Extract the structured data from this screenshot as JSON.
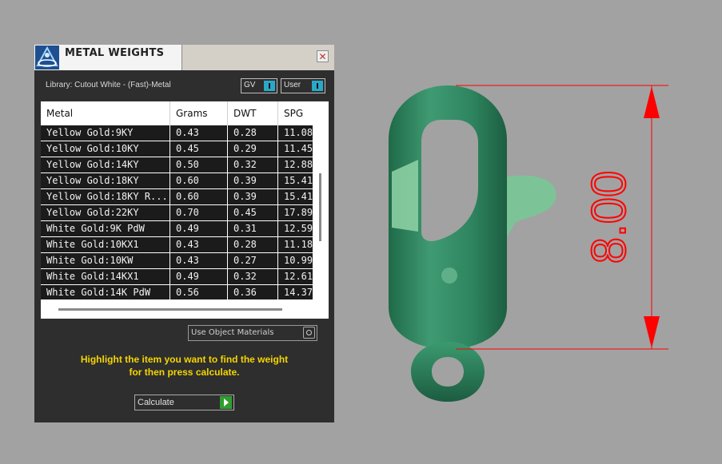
{
  "panel": {
    "title": "METAL WEIGHTS",
    "close_icon": "✕",
    "library_label": "Library: Cutout White - (Fast)-Metal",
    "gv_label": "GV",
    "user_label": "User",
    "use_object_materials": "Use Object Materials",
    "instructions_line1": "Highlight the item you want to find the weight",
    "instructions_line2": "for then press calculate.",
    "calculate_label": "Calculate"
  },
  "table": {
    "headers": [
      "Metal",
      "Grams",
      "DWT",
      "SPG"
    ],
    "rows": [
      {
        "metal": "Yellow Gold:9KY",
        "grams": "0.43",
        "dwt": "0.28",
        "spg": "11.08"
      },
      {
        "metal": "Yellow Gold:10KY",
        "grams": "0.45",
        "dwt": "0.29",
        "spg": "11.45"
      },
      {
        "metal": "Yellow Gold:14KY",
        "grams": "0.50",
        "dwt": "0.32",
        "spg": "12.88"
      },
      {
        "metal": "Yellow Gold:18KY",
        "grams": "0.60",
        "dwt": "0.39",
        "spg": "15.41"
      },
      {
        "metal": "Yellow Gold:18KY R...",
        "grams": "0.60",
        "dwt": "0.39",
        "spg": "15.41"
      },
      {
        "metal": "Yellow Gold:22KY",
        "grams": "0.70",
        "dwt": "0.45",
        "spg": "17.89"
      },
      {
        "metal": "White Gold:9K PdW",
        "grams": "0.49",
        "dwt": "0.31",
        "spg": "12.59"
      },
      {
        "metal": "White Gold:10KX1",
        "grams": "0.43",
        "dwt": "0.28",
        "spg": "11.18"
      },
      {
        "metal": "White Gold:10KW",
        "grams": "0.43",
        "dwt": "0.27",
        "spg": "10.99"
      },
      {
        "metal": "White Gold:14KX1",
        "grams": "0.49",
        "dwt": "0.32",
        "spg": "12.61"
      },
      {
        "metal": "White Gold:14K PdW",
        "grams": "0.56",
        "dwt": "0.36",
        "spg": "14.37"
      }
    ]
  },
  "viewport": {
    "dimension_value": "8.00",
    "dimension_color": "#ff0000",
    "model_color": "#2e7d5a"
  },
  "colors": {
    "panel_bg": "#2e2e2e",
    "accent_cyan": "#2aa8c8",
    "instruction_yellow": "#f5d500",
    "play_green": "#2f9e2f"
  }
}
